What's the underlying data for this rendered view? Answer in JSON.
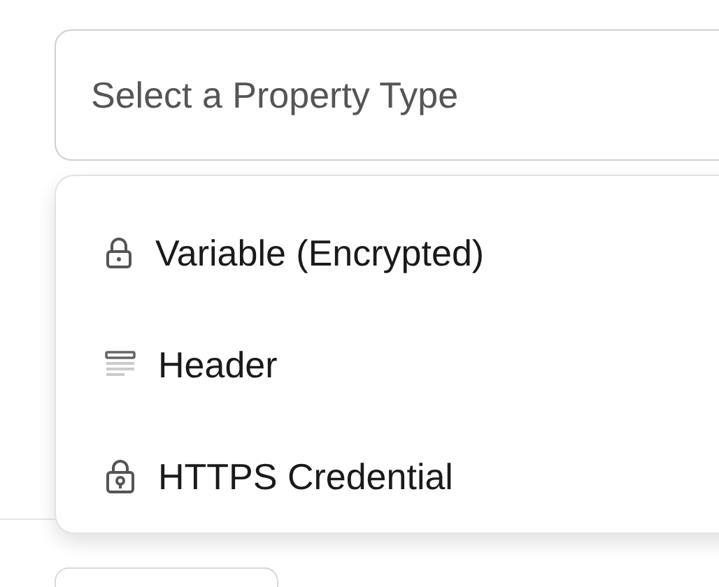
{
  "select": {
    "placeholder": "Select a Property Type",
    "expanded": true
  },
  "options": [
    {
      "label": "Variable (Encrypted)",
      "kind": "lock"
    },
    {
      "label": "Header",
      "kind": "lines"
    },
    {
      "label": "HTTPS Credential",
      "kind": "keylock"
    }
  ]
}
